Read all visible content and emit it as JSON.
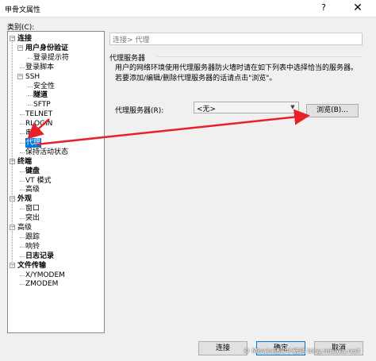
{
  "window": {
    "title": "甲骨文属性",
    "help_icon": "?",
    "close_icon": "✕"
  },
  "category_label": "类别(C):",
  "tree": [
    {
      "label": "连接",
      "bold": true,
      "expander": "−"
    },
    {
      "label": "用户身份验证",
      "bold": true,
      "expander": "−"
    },
    {
      "label": "登录提示符",
      "bold": false
    },
    {
      "label": "登录脚本",
      "bold": false
    },
    {
      "label": "SSH",
      "bold": false,
      "expander": "−"
    },
    {
      "label": "安全性",
      "bold": false
    },
    {
      "label": "隧道",
      "bold": true
    },
    {
      "label": "SFTP",
      "bold": false
    },
    {
      "label": "TELNET",
      "bold": false
    },
    {
      "label": "RLOGIN",
      "bold": false
    },
    {
      "label": "串口",
      "bold": false
    },
    {
      "label": "代理",
      "bold": false,
      "selected": true
    },
    {
      "label": "保持活动状态",
      "bold": false
    },
    {
      "label": "终端",
      "bold": true,
      "expander": "−"
    },
    {
      "label": "键盘",
      "bold": true
    },
    {
      "label": "VT 模式",
      "bold": false
    },
    {
      "label": "高级",
      "bold": false
    },
    {
      "label": "外观",
      "bold": true,
      "expander": "−"
    },
    {
      "label": "窗口",
      "bold": false
    },
    {
      "label": "突出",
      "bold": false
    },
    {
      "label": "高级",
      "bold": false,
      "expander": "−"
    },
    {
      "label": "跟踪",
      "bold": false
    },
    {
      "label": "响铃",
      "bold": false
    },
    {
      "label": "日志记录",
      "bold": true
    },
    {
      "label": "文件传输",
      "bold": true,
      "expander": "−"
    },
    {
      "label": "X/YMODEM",
      "bold": false
    },
    {
      "label": "ZMODEM",
      "bold": false
    }
  ],
  "breadcrumb": "连接> 代理",
  "group_title": "代理服务器",
  "description": "用户的网络环境使用代理服务器防火墙时请在如下列表中选择恰当的服务器。若要添加/编辑/删除代理服务器的话请点击\"浏览\"。",
  "proxy_label": "代理服务器(R):",
  "proxy_select_value": "<无>",
  "browse_button": "浏览(B)...",
  "buttons": {
    "connect": "连接",
    "ok": "确定",
    "cancel": "取消"
  },
  "watermark": "© Misaka镇の小破站 blog.misaka.rest",
  "colors": {
    "selection": "#0078d7",
    "arrow": "#e8202a"
  }
}
